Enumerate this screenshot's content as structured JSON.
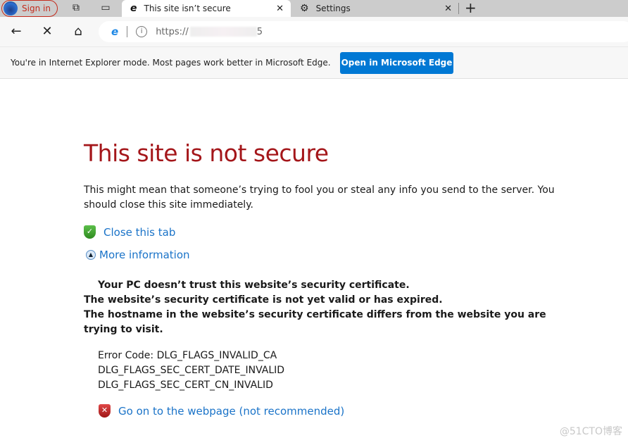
{
  "tabs": {
    "sign_in": "Sign in",
    "active": {
      "title": "This site isn’t secure",
      "icon": "ie-icon"
    },
    "inactive": {
      "title": "Settings",
      "icon": "gear-icon"
    }
  },
  "address": {
    "url_prefix": "https://",
    "url_suffix": "5"
  },
  "infobar": {
    "message": "You're in Internet Explorer mode. Most pages work better in Microsoft Edge.",
    "button": "Open in Microsoft Edge"
  },
  "page": {
    "title": "This site is not secure",
    "description": "This might mean that someone’s trying to fool you or steal any info you send to the server. You should close this site immediately.",
    "close_tab": "Close this tab",
    "more_info": "More information",
    "details": [
      "Your PC doesn’t trust this website’s security certificate.",
      "The website’s security certificate is not yet valid or has expired.",
      "The hostname in the website’s security certificate differs from the website you are trying to visit."
    ],
    "codes": [
      "Error Code: DLG_FLAGS_INVALID_CA",
      "DLG_FLAGS_SEC_CERT_DATE_INVALID",
      "DLG_FLAGS_SEC_CERT_CN_INVALID"
    ],
    "go_on": "Go on to the webpage (not recommended)"
  },
  "watermark": "@51CTO博客",
  "colors": {
    "title": "#a4161a",
    "link": "#1a73c8",
    "button": "#0078d4"
  }
}
